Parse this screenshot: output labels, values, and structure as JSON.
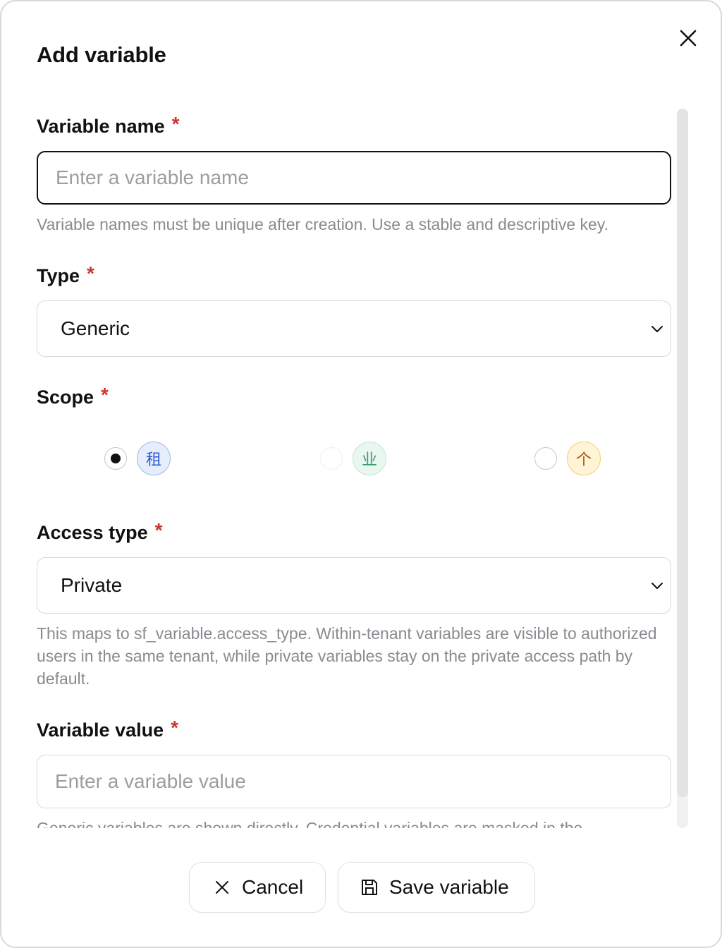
{
  "dialog": {
    "title": "Add variable",
    "close_icon": "close-icon"
  },
  "form": {
    "variable_name": {
      "label": "Variable name",
      "required_mark": "*",
      "placeholder": "Enter a variable name",
      "value": "",
      "help": "Variable names must be unique after creation. Use a stable and descriptive key."
    },
    "type": {
      "label": "Type",
      "required_mark": "*",
      "selected": "Generic"
    },
    "scope": {
      "label": "Scope",
      "required_mark": "*",
      "options": [
        {
          "badge": "租",
          "checked": true,
          "color": "#2f5bd1"
        },
        {
          "badge": "业",
          "checked": false,
          "color": "#3a9b6e"
        },
        {
          "badge": "个",
          "checked": false,
          "color": "#a35a14"
        }
      ]
    },
    "access_type": {
      "label": "Access type",
      "required_mark": "*",
      "selected": "Private",
      "help": "This maps to sf_variable.access_type. Within-tenant variables are visible to authorized users in the same tenant, while private variables stay on the private access path by default."
    },
    "variable_value": {
      "label": "Variable value",
      "required_mark": "*",
      "placeholder": "Enter a variable value",
      "value": "",
      "help": "Generic variables are shown directly. Credential variables are masked in the"
    }
  },
  "footer": {
    "cancel_label": "Cancel",
    "save_label": "Save variable"
  },
  "colors": {
    "required": "#d0342c",
    "help_text": "#8a8a90",
    "border": "#d9d9dd"
  }
}
